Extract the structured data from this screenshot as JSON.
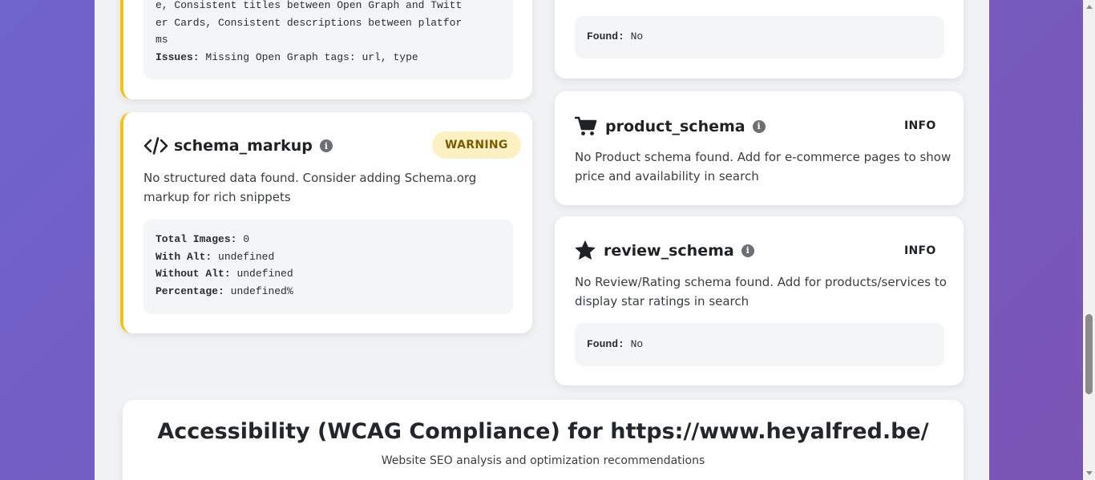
{
  "left_column": {
    "top_card": {
      "code_lines": [
        "e, Consistent titles between Open Graph and Twitt",
        "er Cards, Consistent descriptions between platfor",
        "ms"
      ],
      "issues_label": "Issues:",
      "issues_value": "Missing Open Graph tags: url, type"
    },
    "schema_card": {
      "icon": "code-icon",
      "title": "schema_markup",
      "badge": "WARNING",
      "description": "No structured data found. Consider adding Schema.org markup for rich snippets",
      "details": [
        {
          "label": "Total Images:",
          "value": "0"
        },
        {
          "label": "With Alt:",
          "value": "undefined"
        },
        {
          "label": "Without Alt:",
          "value": "undefined"
        },
        {
          "label": "Percentage:",
          "value": "undefined%"
        }
      ]
    }
  },
  "right_column": {
    "top_card": {
      "found_label": "Found:",
      "found_value": "No"
    },
    "product_card": {
      "icon": "shopping-cart-icon",
      "title": "product_schema",
      "badge": "INFO",
      "description": "No Product schema found. Add for e-commerce pages to show price and availability in search"
    },
    "review_card": {
      "icon": "star-icon",
      "title": "review_schema",
      "badge": "INFO",
      "description": "No Review/Rating schema found. Add for products/services to display star ratings in search",
      "found_label": "Found:",
      "found_value": "No"
    }
  },
  "section": {
    "title": "Accessibility (WCAG Compliance) for https://www.heyalfred.be/",
    "subtitle": "Website SEO analysis and optimization recommendations"
  },
  "colors": {
    "background_gradient": [
      "#6f63cc",
      "#7a55b5"
    ],
    "warning_border": "#f3c416",
    "warning_badge_bg": "#fdf1c3"
  }
}
